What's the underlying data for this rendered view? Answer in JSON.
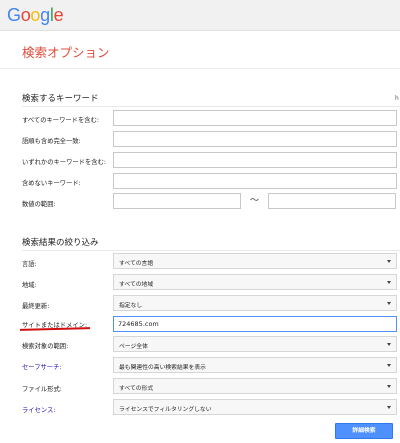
{
  "logo": {
    "letters": [
      "G",
      "o",
      "o",
      "g",
      "l",
      "e"
    ],
    "colors": [
      "#4285f4",
      "#ea4335",
      "#fbbc05",
      "#4285f4",
      "#34a853",
      "#ea4335"
    ]
  },
  "page_title": "検索オプション",
  "keywords_section": {
    "title": "検索するキーワード",
    "edge_mark": "h",
    "rows": [
      {
        "label": "すべてのキーワードを含む:",
        "value": ""
      },
      {
        "label": "語順も含め完全一致:",
        "value": ""
      },
      {
        "label": "いずれかのキーワードを含む:",
        "value": ""
      },
      {
        "label": "含めないキーワード:",
        "value": ""
      }
    ],
    "range_label": "数値の範囲:",
    "range_separator": "～"
  },
  "filter_section": {
    "title": "検索結果の絞り込み",
    "language": {
      "label": "言語:",
      "value": "すべての言語"
    },
    "region": {
      "label": "地域:",
      "value": "すべての地域"
    },
    "last_update": {
      "label": "最終更新:",
      "value": "指定なし"
    },
    "site_domain": {
      "label": "サイトまたはドメイン:",
      "value": "724685.com"
    },
    "search_scope": {
      "label": "検索対象の範囲:",
      "value": "ページ全体"
    },
    "safesearch": {
      "label": "セーフサーチ:",
      "value": "最も関連性の高い検索結果を表示"
    },
    "file_type": {
      "label": "ファイル形式:",
      "value": "すべての形式"
    },
    "license": {
      "label": "ライセンス:",
      "value": "ライセンスでフィルタリングしない"
    }
  },
  "advanced_search_button": "詳細検索",
  "colors": {
    "title_red": "#dd4b39",
    "link_blue": "#1a0dab",
    "button_blue": "#4d90fe",
    "annotation_red": "#d01010"
  }
}
